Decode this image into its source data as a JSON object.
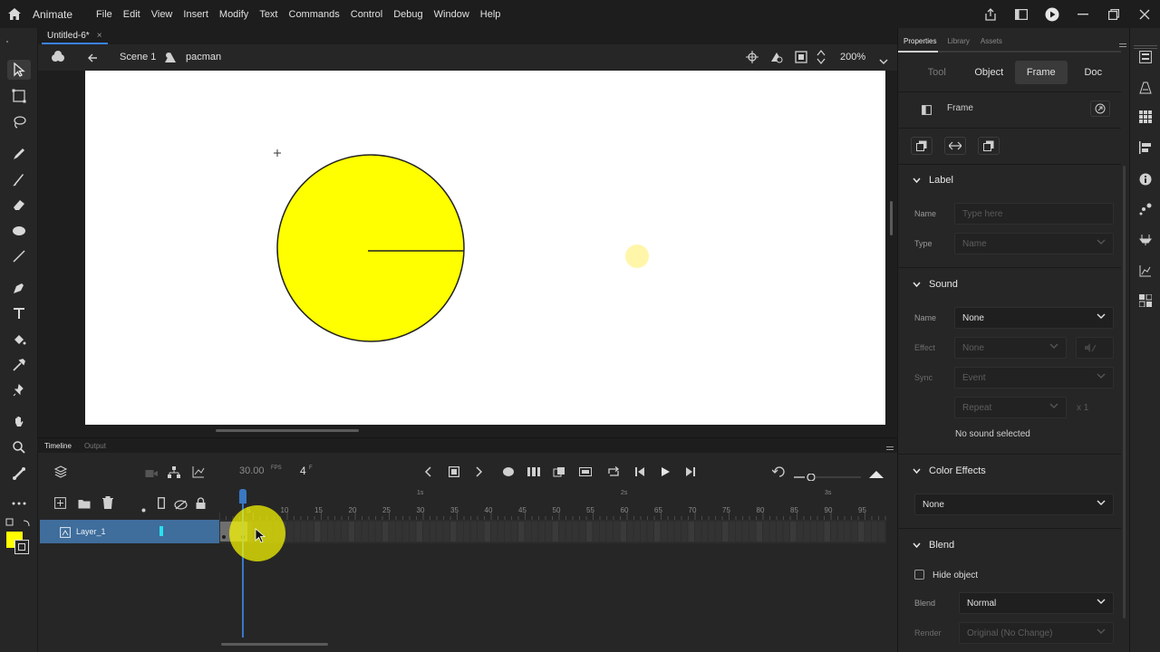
{
  "app": {
    "name": "Animate"
  },
  "menu": [
    "File",
    "Edit",
    "View",
    "Insert",
    "Modify",
    "Text",
    "Commands",
    "Control",
    "Debug",
    "Window",
    "Help"
  ],
  "document": {
    "tab_title": "Untitled-6*",
    "close": "×"
  },
  "editbar": {
    "scene": "Scene 1",
    "symbol": "pacman",
    "zoom": "200%"
  },
  "timeline": {
    "tabs": [
      "Timeline",
      "Output"
    ],
    "fps_value": "30.00",
    "fps_unit": "FPS",
    "current_frame": "4",
    "frame_unit": "F",
    "layer_name": "Layer_1",
    "ruler_seconds": [
      "1s",
      "2s",
      "3s"
    ],
    "ruler_frames": [
      "5",
      "10",
      "15",
      "20",
      "25",
      "30",
      "35",
      "40",
      "45",
      "50",
      "55",
      "60",
      "65",
      "70",
      "75",
      "80",
      "85",
      "90",
      "95"
    ]
  },
  "panel": {
    "tabs": [
      "Properties",
      "Library",
      "Assets"
    ],
    "subtabs": [
      "Tool",
      "Object",
      "Frame",
      "Doc"
    ],
    "active_subtab": "Frame",
    "frame_header": "Frame",
    "label_section": {
      "title": "Label",
      "name_label": "Name",
      "name_placeholder": "Type here",
      "type_label": "Type",
      "type_value": "Name"
    },
    "sound_section": {
      "title": "Sound",
      "name_label": "Name",
      "name_value": "None",
      "effect_label": "Effect",
      "effect_value": "None",
      "sync_label": "Sync",
      "sync_value": "Event",
      "repeat_value": "Repeat",
      "repeat_count": "x 1",
      "status": "No sound selected"
    },
    "color_effects": {
      "title": "Color Effects",
      "value": "None"
    },
    "blend_section": {
      "title": "Blend",
      "hide_object": "Hide object",
      "blend_label": "Blend",
      "blend_value": "Normal",
      "render_label": "Render",
      "render_value": "Original (No Change)"
    }
  },
  "colors": {
    "accent": "#3b82f6",
    "layer_highlight": "#3f6d9c",
    "pacman_fill": "#ffff00",
    "stage": "#ffffff"
  }
}
